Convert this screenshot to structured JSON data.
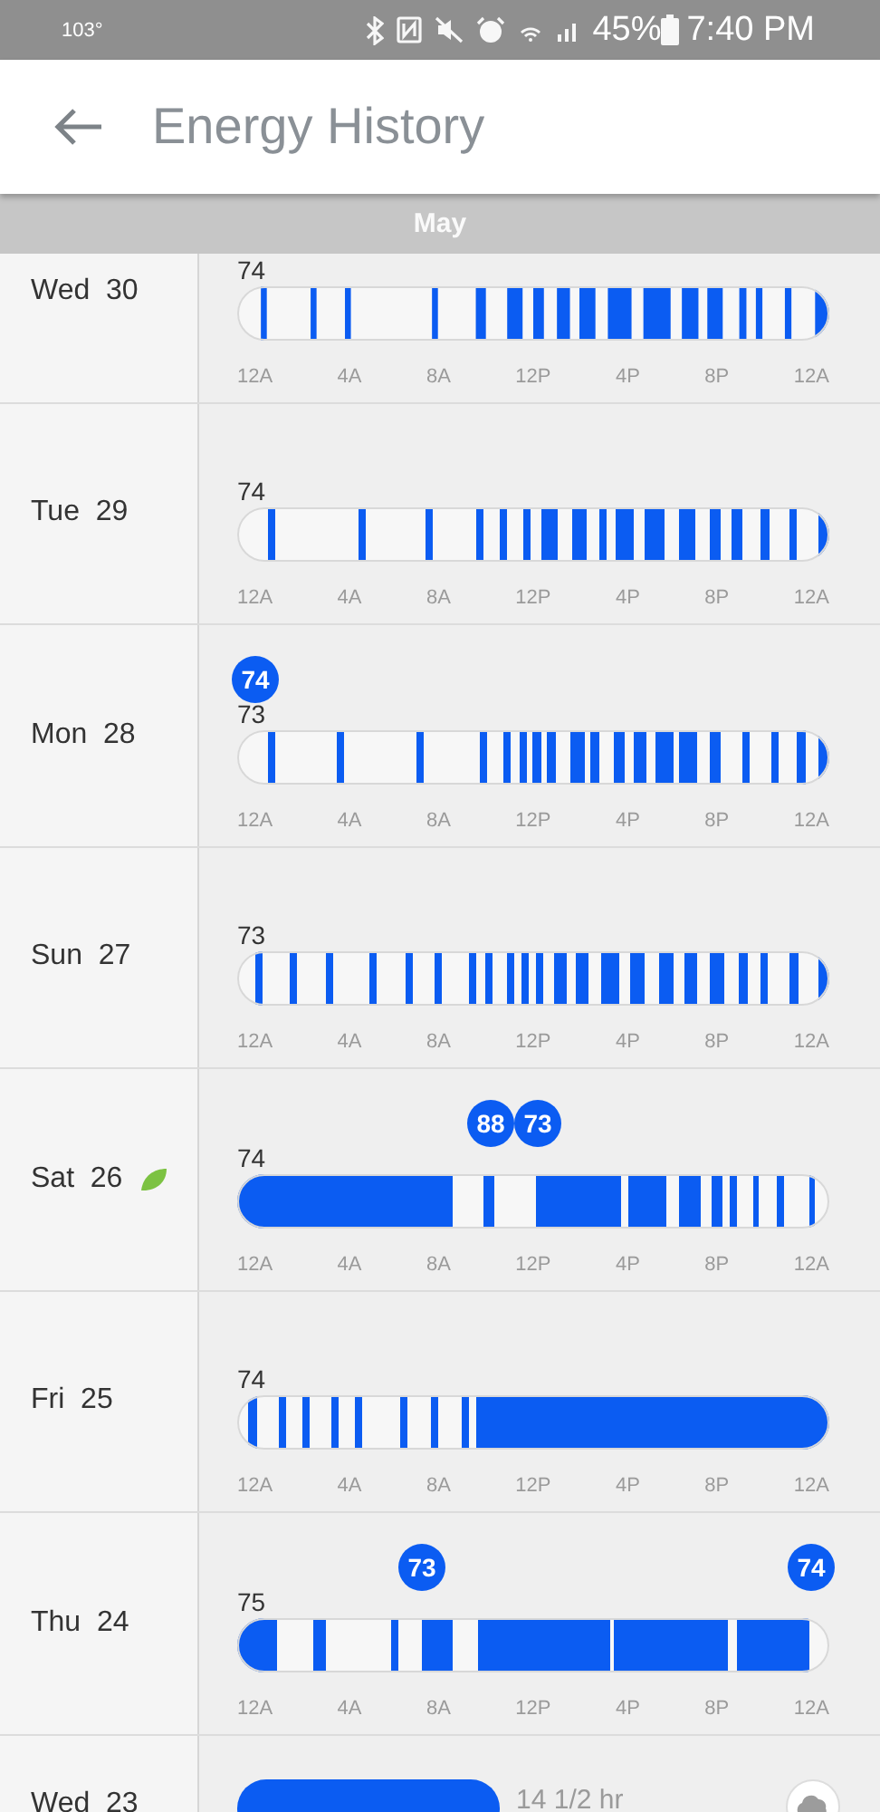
{
  "status_bar": {
    "temperature": "103°",
    "battery": "45%",
    "time": "7:40 PM"
  },
  "header": {
    "title": "Energy History"
  },
  "month": "May",
  "days": [
    {
      "kind": "timeline",
      "day": "Wed",
      "date": "30",
      "eco": false,
      "temp": "74",
      "ticks": [
        "12A",
        "4A",
        "8A",
        "12P",
        "4P",
        "8P",
        "12A"
      ]
    },
    {
      "kind": "timeline",
      "day": "Tue",
      "date": "29",
      "eco": false,
      "temp": "74",
      "ticks": [
        "12A",
        "4A",
        "8A",
        "12P",
        "4P",
        "8P",
        "12A"
      ]
    },
    {
      "kind": "timeline",
      "day": "Mon",
      "date": "28",
      "eco": false,
      "temp": "73",
      "badges": [
        {
          "kind": "label",
          "label": "74"
        }
      ],
      "ticks": [
        "12A",
        "4A",
        "8A",
        "12P",
        "4P",
        "8P",
        "12A"
      ]
    },
    {
      "kind": "timeline",
      "day": "Sun",
      "date": "27",
      "eco": false,
      "temp": "73",
      "ticks": [
        "12A",
        "4A",
        "8A",
        "12P",
        "4P",
        "8P",
        "12A"
      ]
    },
    {
      "kind": "timeline",
      "day": "Sat",
      "date": "26",
      "eco": true,
      "temp": "74",
      "badges": [
        {
          "kind": "label",
          "label": "88"
        },
        {
          "kind": "label",
          "label": "73"
        }
      ],
      "ticks": [
        "12A",
        "4A",
        "8A",
        "12P",
        "4P",
        "8P",
        "12A"
      ]
    },
    {
      "kind": "timeline",
      "day": "Fri",
      "date": "25",
      "eco": false,
      "temp": "74",
      "ticks": [
        "12A",
        "4A",
        "8A",
        "12P",
        "4P",
        "8P",
        "12A"
      ]
    },
    {
      "kind": "timeline",
      "day": "Thu",
      "date": "24",
      "eco": false,
      "temp": "75",
      "badges": [
        {
          "kind": "label",
          "label": "73"
        },
        {
          "kind": "label",
          "label": "74"
        }
      ],
      "ticks": [
        "12A",
        "4A",
        "8A",
        "12P",
        "4P",
        "8P",
        "12A"
      ]
    },
    {
      "kind": "summary",
      "day": "Wed",
      "date": "23",
      "eco": false,
      "duration": "14 1/2 hr"
    }
  ]
}
